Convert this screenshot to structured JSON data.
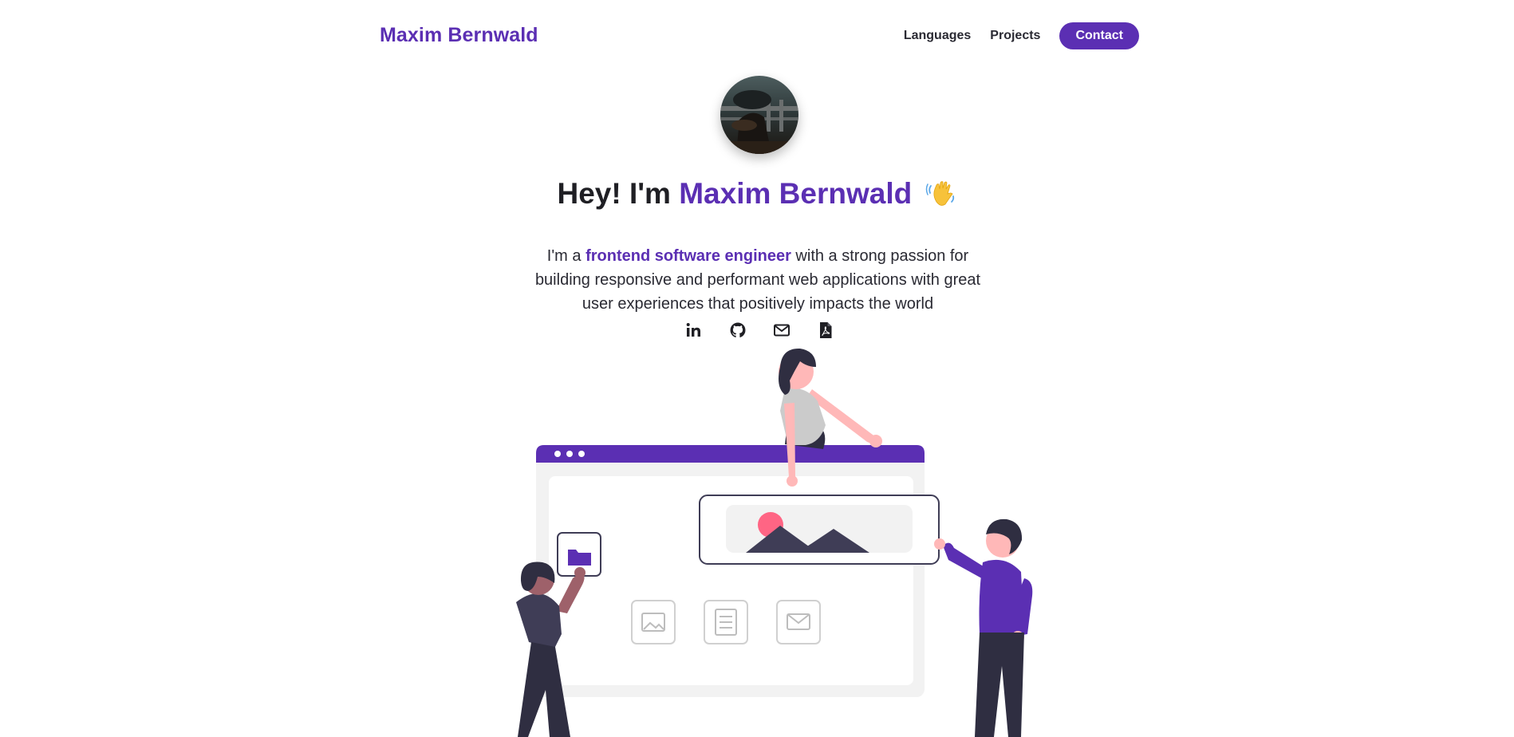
{
  "header": {
    "brand": "Maxim Bernwald",
    "nav": [
      {
        "label": "Languages"
      },
      {
        "label": "Projects"
      },
      {
        "label": "Contact"
      }
    ]
  },
  "hero": {
    "title_prefix": "Hey! I'm ",
    "title_name": "Maxim Bernwald",
    "wave_icon": "waving-hand-icon",
    "sub_prefix": "I'm a ",
    "sub_accent": "frontend software engineer",
    "sub_suffix": " with a strong passion for building responsive and performant web applications with great user experiences that positively impacts the world"
  },
  "socials": [
    {
      "icon": "linkedin-icon"
    },
    {
      "icon": "github-icon"
    },
    {
      "icon": "email-icon"
    },
    {
      "icon": "pdf-resume-icon"
    }
  ],
  "colors": {
    "accent": "#5b2fb3",
    "text": "#1f1f24",
    "background": "#ffffff"
  }
}
